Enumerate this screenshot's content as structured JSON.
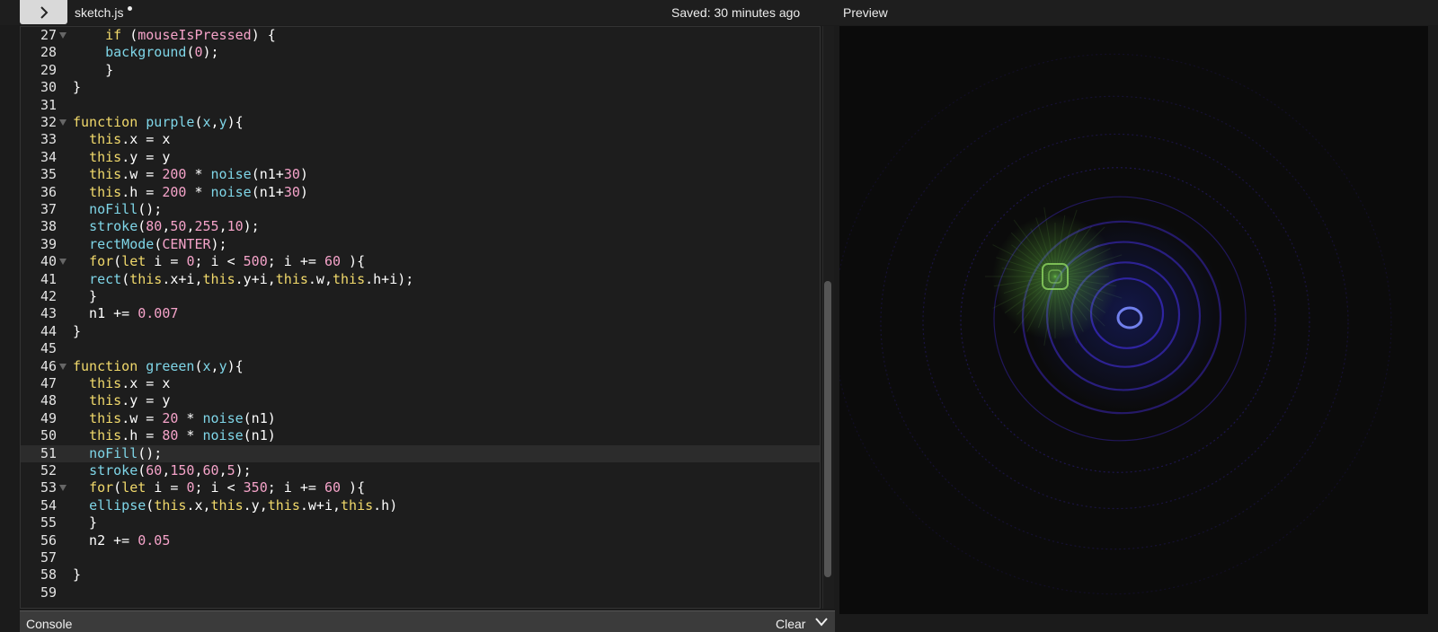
{
  "toolbar": {
    "file_name": "sketch.js",
    "saved_status": "Saved: 30 minutes ago",
    "preview_label": "Preview"
  },
  "editor": {
    "active_line": "51",
    "lines": [
      {
        "num": "27",
        "fold": true,
        "text": "    if (mouseIsPressed) {"
      },
      {
        "num": "28",
        "fold": false,
        "text": "    background(0);"
      },
      {
        "num": "29",
        "fold": false,
        "text": "    }"
      },
      {
        "num": "30",
        "fold": false,
        "text": "}"
      },
      {
        "num": "31",
        "fold": false,
        "text": ""
      },
      {
        "num": "32",
        "fold": true,
        "text": "function purple(x,y){"
      },
      {
        "num": "33",
        "fold": false,
        "text": "  this.x = x"
      },
      {
        "num": "34",
        "fold": false,
        "text": "  this.y = y"
      },
      {
        "num": "35",
        "fold": false,
        "text": "  this.w = 200 * noise(n1+30)"
      },
      {
        "num": "36",
        "fold": false,
        "text": "  this.h = 200 * noise(n1+30)"
      },
      {
        "num": "37",
        "fold": false,
        "text": "  noFill();"
      },
      {
        "num": "38",
        "fold": false,
        "text": "  stroke(80,50,255,10);"
      },
      {
        "num": "39",
        "fold": false,
        "text": "  rectMode(CENTER);"
      },
      {
        "num": "40",
        "fold": true,
        "text": "  for(let i = 0; i < 500; i += 60 ){"
      },
      {
        "num": "41",
        "fold": false,
        "text": "  rect(this.x+i,this.y+i,this.w,this.h+i);"
      },
      {
        "num": "42",
        "fold": false,
        "text": "  }"
      },
      {
        "num": "43",
        "fold": false,
        "text": "  n1 += 0.007"
      },
      {
        "num": "44",
        "fold": false,
        "text": "}"
      },
      {
        "num": "45",
        "fold": false,
        "text": ""
      },
      {
        "num": "46",
        "fold": true,
        "text": "function greeen(x,y){"
      },
      {
        "num": "47",
        "fold": false,
        "text": "  this.x = x"
      },
      {
        "num": "48",
        "fold": false,
        "text": "  this.y = y"
      },
      {
        "num": "49",
        "fold": false,
        "text": "  this.w = 20 * noise(n1)"
      },
      {
        "num": "50",
        "fold": false,
        "text": "  this.h = 80 * noise(n1)"
      },
      {
        "num": "51",
        "fold": false,
        "text": "  noFill();"
      },
      {
        "num": "52",
        "fold": false,
        "text": "  stroke(60,150,60,5);"
      },
      {
        "num": "53",
        "fold": true,
        "text": "  for(let i = 0; i < 350; i += 60 ){"
      },
      {
        "num": "54",
        "fold": false,
        "text": "  ellipse(this.x,this.y,this.w+i,this.h)"
      },
      {
        "num": "55",
        "fold": false,
        "text": "  }"
      },
      {
        "num": "56",
        "fold": false,
        "text": "  n2 += 0.05"
      },
      {
        "num": "57",
        "fold": false,
        "text": ""
      },
      {
        "num": "58",
        "fold": false,
        "text": "}"
      },
      {
        "num": "59",
        "fold": false,
        "text": ""
      }
    ]
  },
  "console": {
    "label": "Console",
    "clear_label": "Clear"
  },
  "colors": {
    "keyword": "#f1d96b",
    "function": "#7fd6e8",
    "number": "#f5a3c9",
    "purple_stroke": "#5032ff",
    "green_stroke": "#3c963c"
  },
  "icons": {
    "toggle": "chevron-right-icon",
    "console_toggle": "chevron-down-icon"
  }
}
